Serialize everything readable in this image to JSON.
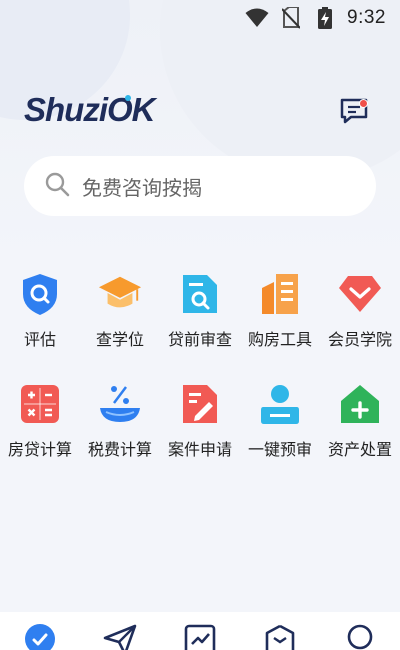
{
  "status_bar": {
    "time": "9:32",
    "icons": [
      "wifi-icon",
      "no-sim-icon",
      "battery-charging-icon"
    ]
  },
  "header": {
    "logo_text": "ShuziOK",
    "message_icon": "message-icon",
    "has_unread": true
  },
  "search": {
    "placeholder": "免费咨询按揭"
  },
  "grid": [
    {
      "label": "评估",
      "icon": "shield-search-icon",
      "color": "#2f7ff0"
    },
    {
      "label": "查学位",
      "icon": "graduation-cap-icon",
      "color": "#f79a2d"
    },
    {
      "label": "贷前审查",
      "icon": "document-search-icon",
      "color": "#2fb6e8"
    },
    {
      "label": "购房工具",
      "icon": "building-icon",
      "color": "#f48a2a"
    },
    {
      "label": "会员学院",
      "icon": "diamond-check-icon",
      "color": "#f15a54"
    },
    {
      "label": "房贷计算",
      "icon": "calculator-icon",
      "color": "#f15a54"
    },
    {
      "label": "税费计算",
      "icon": "percent-bowl-icon",
      "color": "#2f7ff0"
    },
    {
      "label": "案件申请",
      "icon": "document-edit-icon",
      "color": "#f15a54"
    },
    {
      "label": "一键预审",
      "icon": "user-badge-icon",
      "color": "#2fb6e8"
    },
    {
      "label": "资产处置",
      "icon": "house-plus-icon",
      "color": "#2fb35a"
    }
  ],
  "tabbar": [
    "home-check-icon",
    "send-icon",
    "chart-icon",
    "cube-icon",
    "profile-icon"
  ],
  "colors": {
    "accent": "#2f7ff0",
    "brand": "#1f2d5a",
    "background": "#f3f5fa"
  }
}
